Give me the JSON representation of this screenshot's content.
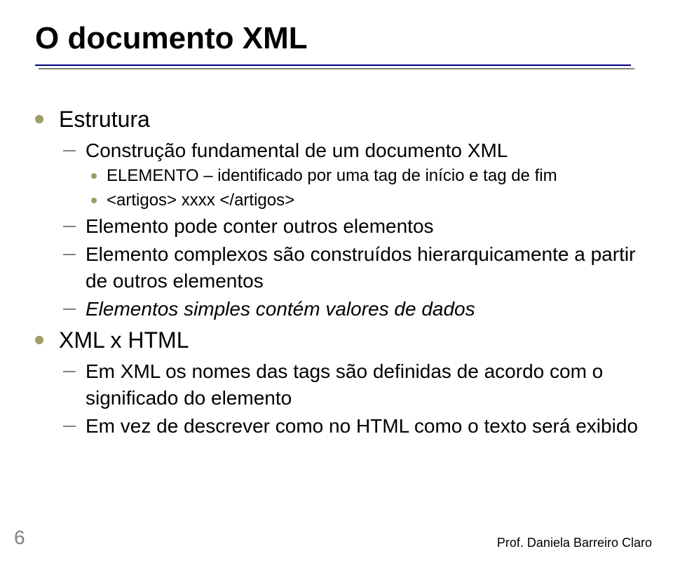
{
  "title": "O documento XML",
  "content": {
    "b1": "Estrutura",
    "b1_d1": "Construção fundamental de um documento XML",
    "b1_d1_s1": "ELEMENTO – identificado por uma tag de início e tag de fim",
    "b1_d1_s2": "<artigos> xxxx </artigos>",
    "b1_d2": "Elemento pode conter outros elementos",
    "b1_d3": "Elemento complexos são construídos hierarquicamente a partir de outros elementos",
    "b1_d4": "Elementos simples contém valores de dados",
    "b2": "XML x HTML",
    "b2_d1": "Em XML os nomes das tags são definidas de acordo com o significado do elemento",
    "b2_d2": "Em vez de descrever como no HTML como o texto será exibido"
  },
  "page_number": "6",
  "footer": "Prof. Daniela Barreiro Claro"
}
